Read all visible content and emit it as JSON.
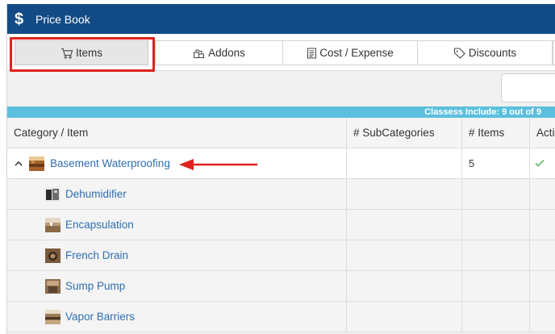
{
  "header": {
    "title": "Price Book",
    "icon": "dollar-icon"
  },
  "tabs": [
    {
      "label": "Items",
      "icon": "cart-icon",
      "active": true
    },
    {
      "label": "Addons",
      "icon": "addons-icon",
      "active": false
    },
    {
      "label": "Cost / Expense",
      "icon": "receipt-icon",
      "active": false
    },
    {
      "label": "Discounts",
      "icon": "tag-icon",
      "active": false
    }
  ],
  "classes_bar": {
    "text": "Classess Include: 9 out of 9"
  },
  "table": {
    "columns": [
      "Category / Item",
      "# SubCategories",
      "# Items",
      "Active"
    ],
    "rows": [
      {
        "name": "Basement Waterproofing",
        "subcategories": "",
        "items": "5",
        "active": true,
        "expanded": true,
        "level": 0
      },
      {
        "name": "Dehumidifier",
        "subcategories": "",
        "items": "",
        "active": false,
        "level": 1
      },
      {
        "name": "Encapsulation",
        "subcategories": "",
        "items": "",
        "active": false,
        "level": 1
      },
      {
        "name": "French Drain",
        "subcategories": "",
        "items": "",
        "active": false,
        "level": 1
      },
      {
        "name": "Sump Pump",
        "subcategories": "",
        "items": "",
        "active": false,
        "level": 1
      },
      {
        "name": "Vapor Barriers",
        "subcategories": "",
        "items": "",
        "active": false,
        "level": 1
      }
    ]
  },
  "colors": {
    "header_bg": "#124b86",
    "accent_bar": "#5bc0de",
    "link": "#2f6fb0",
    "highlight": "#e0221e",
    "check": "#5cb85c"
  }
}
